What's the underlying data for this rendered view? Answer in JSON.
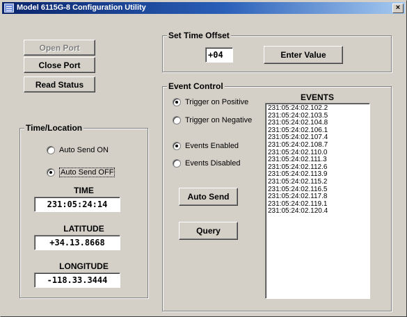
{
  "window": {
    "title": "Model 6115G-8 Configuration Utility",
    "close_label": "×"
  },
  "port_buttons": {
    "open_port": "Open Port",
    "close_port": "Close Port",
    "read_status": "Read Status"
  },
  "time_offset": {
    "group_label": "Set Time Offset",
    "value": "+04",
    "enter_button": "Enter Value"
  },
  "time_location": {
    "group_label": "Time/Location",
    "auto_send_on": "Auto Send ON",
    "auto_send_off": "Auto Send OFF",
    "selected": "auto_send_off",
    "time_label": "TIME",
    "time_value": "231:05:24:14",
    "latitude_label": "LATITUDE",
    "latitude_value": "+34.13.8668",
    "longitude_label": "LONGITUDE",
    "longitude_value": "-118.33.3444"
  },
  "event_control": {
    "group_label": "Event Control",
    "trigger_positive": "Trigger on Positive",
    "trigger_negative": "Trigger on Negative",
    "trigger_selected": "positive",
    "events_enabled": "Events Enabled",
    "events_disabled": "Events Disabled",
    "events_selected": "enabled",
    "auto_send_button": "Auto Send",
    "query_button": "Query",
    "events_header": "EVENTS",
    "events": [
      "231:05:24:02.102.2",
      "231:05:24:02.103.5",
      "231:05:24:02.104.8",
      "231:05:24:02.106.1",
      "231:05:24:02.107.4",
      "231:05:24:02.108.7",
      "231:05:24:02.110.0",
      "231:05:24:02.111.3",
      "231:05:24:02.112.6",
      "231:05:24:02.113.9",
      "231:05:24:02.115.2",
      "231:05:24:02.116.5",
      "231:05:24:02.117.8",
      "231:05:24:02.119.1",
      "231:05:24:02.120.4"
    ]
  }
}
